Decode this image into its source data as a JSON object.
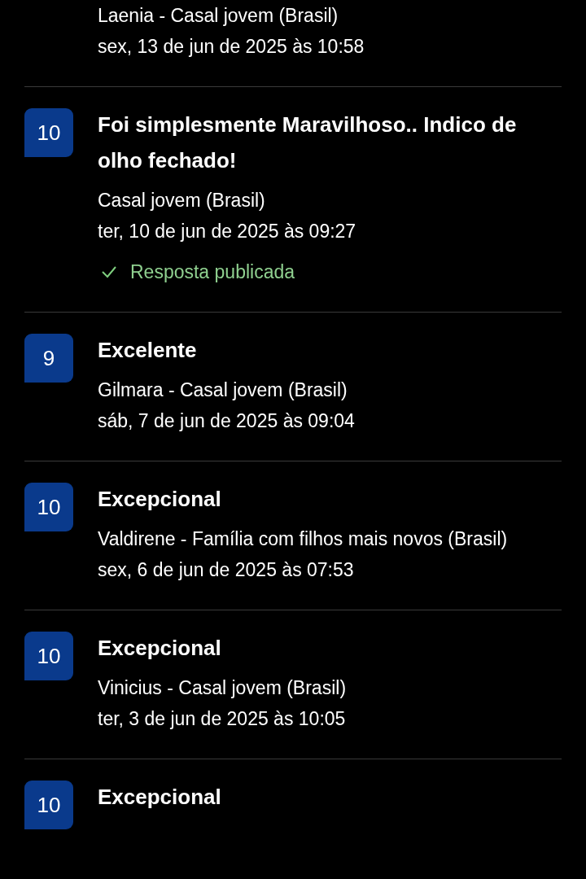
{
  "reviews": [
    {
      "author": "Laenia - Casal jovem (Brasil)",
      "date": "sex, 13 de jun de 2025 às 10:58"
    },
    {
      "score": "10",
      "title": "Foi simplesmente Maravilhoso.. Indico de olho fechado!",
      "author": "Casal jovem (Brasil)",
      "date": "ter, 10 de jun de 2025 às 09:27",
      "reply": "Resposta publicada"
    },
    {
      "score": "9",
      "title": "Excelente",
      "author": "Gilmara - Casal jovem (Brasil)",
      "date": "sáb, 7 de jun de 2025 às 09:04"
    },
    {
      "score": "10",
      "title": "Excepcional",
      "author": "Valdirene - Família com filhos mais novos (Brasil)",
      "date": "sex, 6 de jun de 2025 às 07:53"
    },
    {
      "score": "10",
      "title": "Excepcional",
      "author": "Vinicius - Casal jovem (Brasil)",
      "date": "ter, 3 de jun de 2025 às 10:05"
    },
    {
      "score": "10",
      "title": "Excepcional"
    }
  ]
}
